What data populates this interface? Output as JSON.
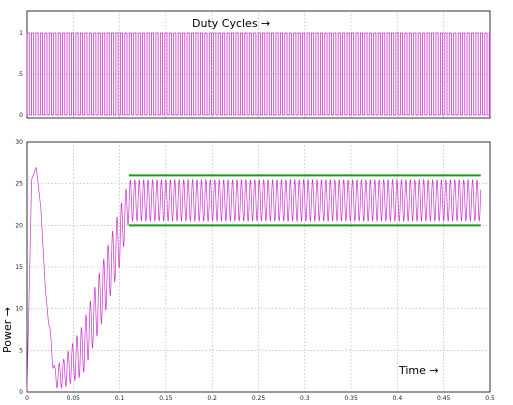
{
  "chart_data": [
    {
      "type": "line",
      "annotation": "Duty Cycles →",
      "xlim": [
        0,
        0.5
      ],
      "ylim": [
        0,
        1
      ],
      "yticks": [
        "0",
        ".5",
        "1"
      ],
      "grid": true,
      "series": [
        {
          "color": "#cc33cc",
          "values": "square pulse train toggling between 0 and 1 throughout 0–0.5 s"
        }
      ]
    },
    {
      "type": "line",
      "ylabel": "Power →",
      "annotation": "Time →",
      "xlim": [
        0,
        0.5
      ],
      "ylim": [
        0,
        30
      ],
      "xticks": [
        "0",
        "0.05",
        "0.1",
        "0.15",
        "0.2",
        "0.25",
        "0.3",
        "0.35",
        "0.4",
        "0.45",
        "0.5"
      ],
      "yticks": [
        "0",
        "5",
        "10",
        "15",
        "20",
        "25",
        "30"
      ],
      "grid": true,
      "series": [
        {
          "color": "#cc33cc",
          "envelope_upper": [
            [
              0,
              0
            ],
            [
              0.005,
              25.5
            ],
            [
              0.01,
              27
            ],
            [
              0.015,
              22
            ],
            [
              0.02,
              12
            ],
            [
              0.03,
              3
            ],
            [
              0.04,
              4
            ],
            [
              0.06,
              8
            ],
            [
              0.08,
              15
            ],
            [
              0.1,
              22
            ],
            [
              0.11,
              25.5
            ],
            [
              0.49,
              25.5
            ]
          ],
          "envelope_lower": [
            [
              0,
              0
            ],
            [
              0.005,
              25.5
            ],
            [
              0.01,
              27
            ],
            [
              0.015,
              22
            ],
            [
              0.02,
              12
            ],
            [
              0.03,
              0.5
            ],
            [
              0.04,
              0.5
            ],
            [
              0.06,
              2
            ],
            [
              0.08,
              8
            ],
            [
              0.1,
              15
            ],
            [
              0.11,
              20.5
            ],
            [
              0.49,
              20.5
            ]
          ]
        },
        {
          "color": "#1a9a1a",
          "points": [
            [
              0.11,
              26
            ],
            [
              0.49,
              26
            ]
          ]
        },
        {
          "color": "#1a9a1a",
          "points": [
            [
              0.11,
              20
            ],
            [
              0.49,
              20
            ]
          ]
        }
      ]
    }
  ]
}
